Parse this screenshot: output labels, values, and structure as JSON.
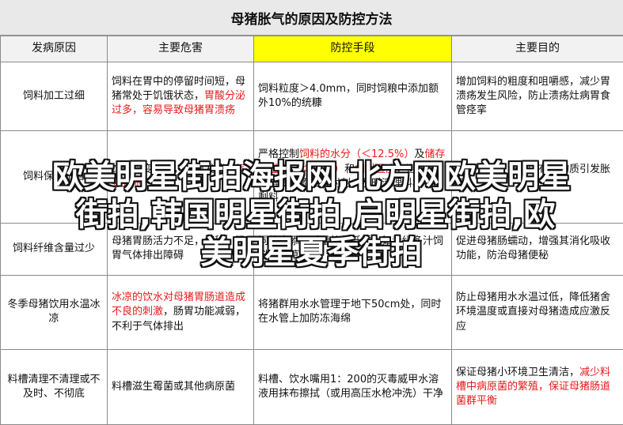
{
  "title": "母猪胀气的原因及防控方法",
  "headers": [
    "发病原因",
    "主要危害",
    "防控手段",
    "主要目的"
  ],
  "rows": [
    {
      "cause": "饲料加工过细",
      "harm": [
        {
          "t": "饲料在胃中的停留时间短，母猪常处于饥饿状态，"
        },
        {
          "t": "胃酸分泌过多，容易导致母猪胃溃疡",
          "red": true
        }
      ],
      "control": [
        {
          "t": "饲料粒度＞4.0mm，同时饲粮中添加额外10%的统糠"
        }
      ],
      "goal": [
        {
          "t": "增加饲料的粗度和咀嚼感，减少胃溃疡发生风险，防止溃疡灶病胃食管痉挛"
        }
      ]
    },
    {
      "cause": "饲料保存不当",
      "harm": [
        {
          "t": "饲料霉变酸败，霉菌发酵"
        },
        {
          "t": "产气导致胀气",
          "red": true
        }
      ],
      "control": [
        {
          "t": "严格控制"
        },
        {
          "t": "饲料的水分（＜12.5%）",
          "red": true
        },
        {
          "t": "及"
        },
        {
          "t": "储存的温度（＜15℃）",
          "red": true
        },
        {
          "t": "和"
        },
        {
          "t": "相对湿度",
          "red": true
        },
        {
          "t": "，避免饲料霉变，添加吸附剂，及时清理料槽中的剩料"
        }
      ],
      "goal": [
        {
          "t": "防止饲料变质产生有毒物质引发胀气"
        }
      ]
    },
    {
      "cause": "饲料纤维含量过少",
      "harm": [
        {
          "t": "母猪胃肠活力不足，便秘，肠胃气体排出障碍"
        }
      ],
      "control": [
        {
          "t": "饲粮中添加适量的粗纤维，如青绿多汁饲料、青草"
        }
      ],
      "goal": [
        {
          "t": "促进母猪肠蠕动，增强其消化吸收功能，防治母猪便秘"
        }
      ]
    },
    {
      "cause": "冬季母猪饮用水温冰凉",
      "harm": [
        {
          "t": "冰凉的饮水对母猪胃肠道造成不良的刺激",
          "red": true
        },
        {
          "t": "，肠胃功能减弱，不利于气体排出"
        }
      ],
      "control": [
        {
          "t": "将猪群用水水管理于地下50cm处，同时在水管上加防冻海绵"
        }
      ],
      "goal": [
        {
          "t": "防止母猪用水水温过低，降低猪舍环境温度或直接对母猪造成应激反应"
        }
      ]
    },
    {
      "cause": "料槽清理不清理或不及时、不彻底",
      "harm": [
        {
          "t": "料槽滋生霉菌或其他病原菌"
        }
      ],
      "control": [
        {
          "t": "料槽、饮水嘴用1：200的灭毒威甲水溶液用抹布擦拭（或用高压水枪冲洗）干净"
        }
      ],
      "goal": [
        {
          "t": "保证母猪小环境卫生清洁，"
        },
        {
          "t": "减少料槽中病原菌的繁殖，保证母猪肠道菌群平衡",
          "red": true
        }
      ]
    }
  ],
  "watermark": [
    "欧美明星街拍海报网,北方网欧美明星",
    "街拍,韩国明星街拍,启明星街拍,欧",
    "美明星夏季街拍"
  ]
}
